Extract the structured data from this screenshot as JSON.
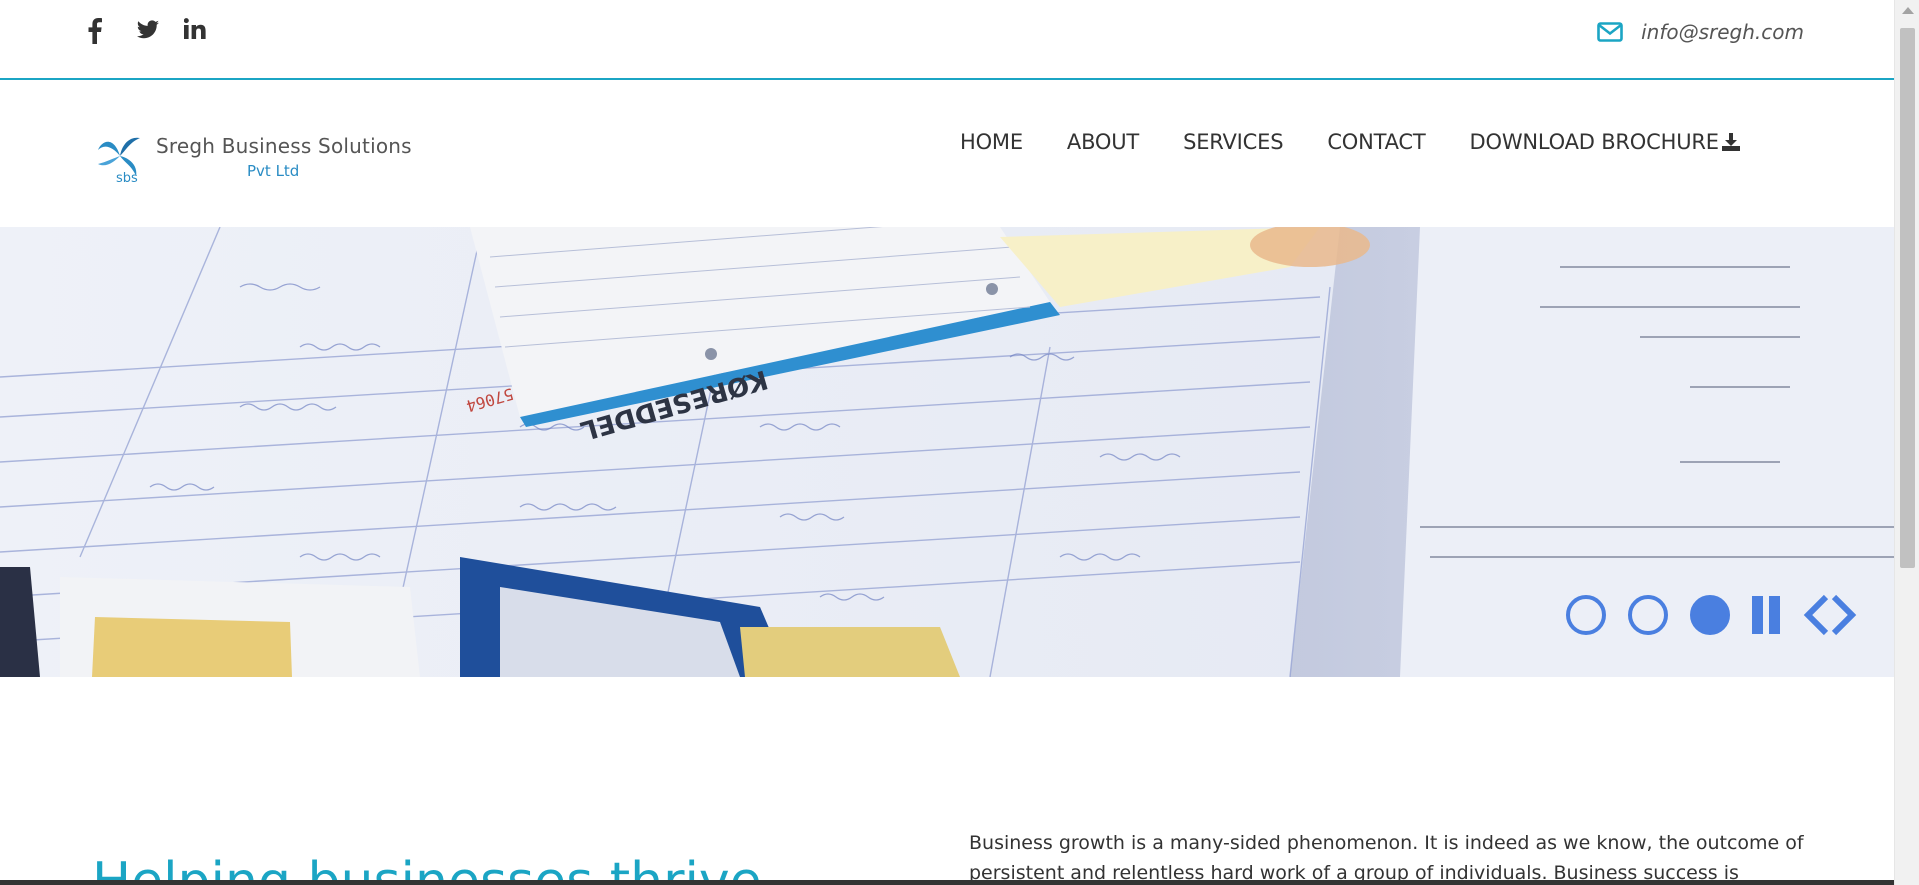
{
  "social": {
    "items": [
      {
        "icon": "facebook-icon"
      },
      {
        "icon": "twitter-icon"
      },
      {
        "icon": "linkedin-icon"
      }
    ]
  },
  "contact": {
    "icon": "envelope-icon",
    "email": "info@sregh.com"
  },
  "logo": {
    "mark": "sbs",
    "name": "Sregh Business Solutions",
    "sub": "Pvt Ltd"
  },
  "nav": {
    "home": "HOME",
    "about": "ABOUT",
    "services": "SERVICES",
    "contact": "CONTACT",
    "brochure": "DOWNLOAD BROCHURE"
  },
  "hero": {
    "image_text": [
      "KØRESEDDEL",
      "57064"
    ],
    "slides_total": 3,
    "active_slide": 3
  },
  "intro": {
    "title": "Helping businesses thrive",
    "text": "Business growth is a many-sided phenomenon. It is indeed as we know, the outcome of persistent and relentless hard work of a group of individuals. Business success is"
  },
  "colors": {
    "accent": "#1ba5c4",
    "slider": "#4a7fe0",
    "logo_blue": "#2a8cc4"
  }
}
